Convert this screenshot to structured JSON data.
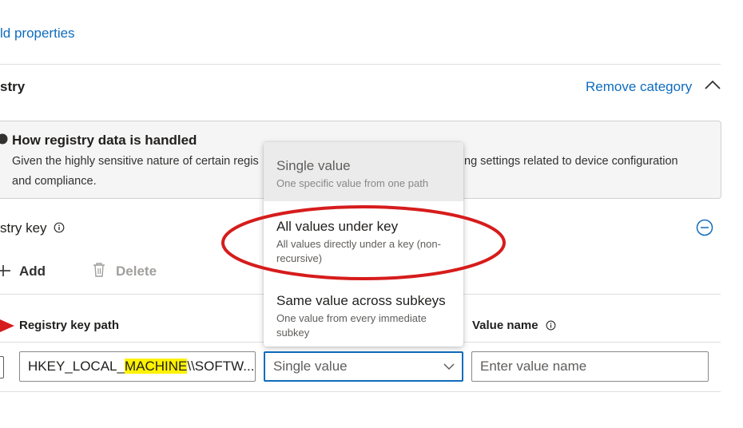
{
  "top_link": "ld properties",
  "section": {
    "title": "stry",
    "remove_label": "Remove category"
  },
  "info": {
    "title": "How registry data is handled",
    "body_left": "Given the highly sensitive nature of certain regis",
    "body_right": "ng settings related to device configuration",
    "body_line2": "and compliance."
  },
  "registry_key": {
    "label": "stry key",
    "add_label": "Add",
    "delete_label": "Delete"
  },
  "columns": {
    "registry_key_path": "Registry key path",
    "value_name": "Value name"
  },
  "row": {
    "path_prefix": "HKEY_LOCAL_",
    "path_highlight": "MACHINE",
    "path_suffix": "\\\\SOFTW...",
    "select_value": "Single value",
    "value_name_placeholder": "Enter value name"
  },
  "dropdown": {
    "options": [
      {
        "label": "Single value",
        "desc": "One specific value from one path"
      },
      {
        "label": "All values under key",
        "desc": "All values directly under a key (non-recursive)"
      },
      {
        "label": "Same value across subkeys",
        "desc": "One value from every immediate subkey"
      }
    ]
  },
  "colors": {
    "accent": "#0f6cbd",
    "highlight": "#fff200",
    "annotation": "#d61c1c"
  }
}
